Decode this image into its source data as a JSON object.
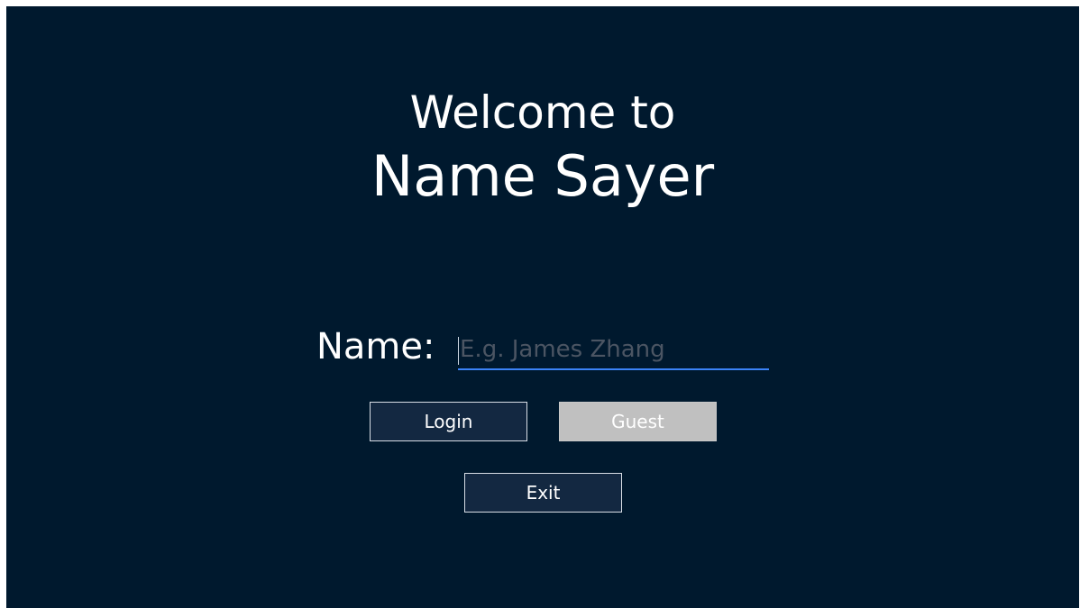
{
  "welcome": {
    "line1": "Welcome to",
    "line2": "Name Sayer"
  },
  "form": {
    "name_label": "Name:",
    "name_value": "",
    "name_placeholder": "E.g. James Zhang"
  },
  "buttons": {
    "login": "Login",
    "guest": "Guest",
    "exit": "Exit"
  },
  "colors": {
    "background": "#00192e",
    "button": "#132841",
    "guest_button": "#c0c0c0",
    "input_underline": "#3b82f6"
  }
}
